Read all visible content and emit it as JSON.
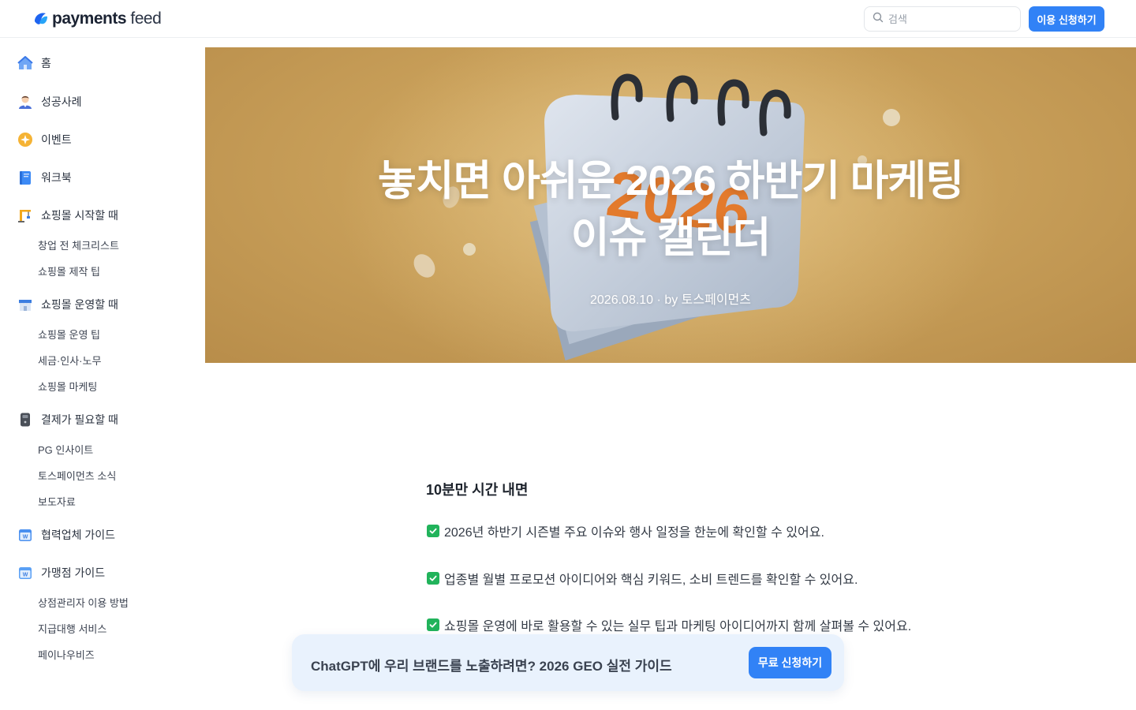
{
  "header": {
    "logo_text_bold": "payments",
    "logo_text_light": "feed",
    "search_placeholder": "검색",
    "cta_label": "이용 신청하기"
  },
  "sidebar": {
    "items": [
      {
        "label": "홈",
        "icon": "home-icon"
      },
      {
        "label": "성공사례",
        "icon": "person-icon"
      },
      {
        "label": "이벤트",
        "icon": "star-badge-icon"
      },
      {
        "label": "워크북",
        "icon": "book-icon"
      },
      {
        "label": "쇼핑몰 시작할 때",
        "icon": "crane-icon"
      },
      {
        "label": "쇼핑몰 운영할 때",
        "icon": "store-icon"
      },
      {
        "label": "결제가 필요할 때",
        "icon": "card-reader-icon"
      },
      {
        "label": "협력업체 가이드",
        "icon": "partner-window-icon"
      },
      {
        "label": "가맹점 가이드",
        "icon": "merchant-window-icon"
      }
    ],
    "sub_start": [
      "창업 전 체크리스트",
      "쇼핑몰 제작 팁"
    ],
    "sub_operate": [
      "쇼핑몰 운영 팁",
      "세금·인사·노무",
      "쇼핑몰 마케팅"
    ],
    "sub_payment": [
      "PG 인사이트",
      "토스페이먼츠 소식",
      "보도자료"
    ],
    "sub_merchant": [
      "상점관리자 이용 방법",
      "지급대행 서비스",
      "페이나우비즈"
    ]
  },
  "hero": {
    "title_line1": "놓치면 아쉬운 2026 하반기 마케팅",
    "title_line2": "이슈 캘린더",
    "date": "2026.08.10",
    "author": "by 토스페이먼츠",
    "calendar_year": "2026"
  },
  "article": {
    "summary_title": "10분만 시간 내면",
    "points": [
      "2026년 하반기 시즌별 주요 이슈와 행사 일정을 한눈에 확인할 수 있어요.",
      "업종별 월별 프로모션 아이디어와 핵심 키워드, 소비 트렌드를 확인할 수 있어요.",
      "쇼핑몰 운영에 바로 활용할 수 있는 실무 팁과 마케팅 아이디어까지 함께 살펴볼 수 있어요."
    ]
  },
  "banner": {
    "text": "ChatGPT에 우리 브랜드를 노출하려면? 2026 GEO 실전 가이드",
    "button": "무료 신청하기"
  },
  "colors": {
    "accent": "#3182f6",
    "check": "#21b35b",
    "banner_bg": "#e9f2fd",
    "hero_bg": "#c9a05a"
  }
}
